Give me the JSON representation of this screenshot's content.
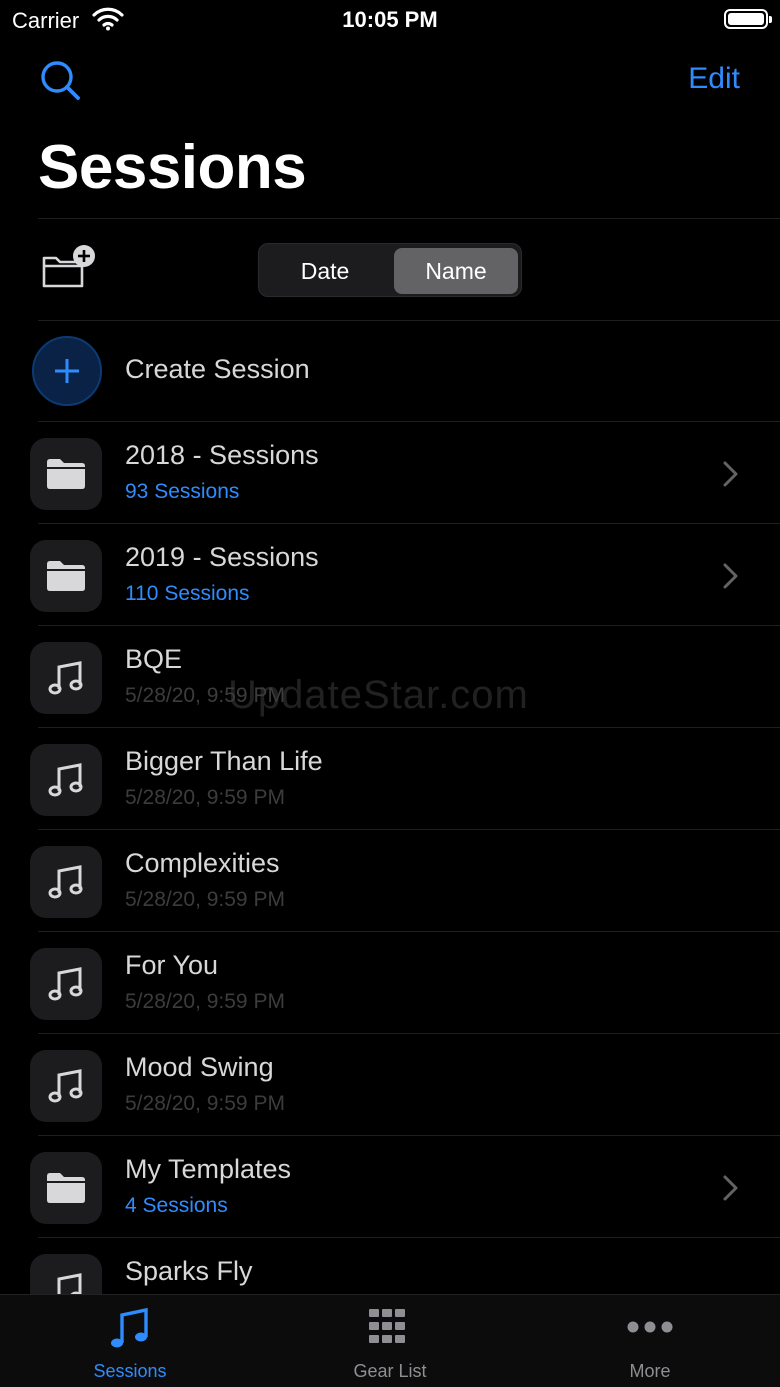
{
  "status_bar": {
    "carrier": "Carrier",
    "time": "10:05 PM"
  },
  "nav": {
    "edit_label": "Edit"
  },
  "title": "Sessions",
  "sort": {
    "date_label": "Date",
    "name_label": "Name",
    "selected": "Name"
  },
  "create_label": "Create Session",
  "rows": [
    {
      "title": "2018 - Sessions",
      "subtitle": "93 Sessions",
      "kind": "folder"
    },
    {
      "title": "2019 - Sessions",
      "subtitle": "110 Sessions",
      "kind": "folder"
    },
    {
      "title": "BQE",
      "subtitle": "5/28/20, 9:59 PM",
      "kind": "session"
    },
    {
      "title": "Bigger Than Life",
      "subtitle": "5/28/20, 9:59 PM",
      "kind": "session"
    },
    {
      "title": "Complexities",
      "subtitle": "5/28/20, 9:59 PM",
      "kind": "session"
    },
    {
      "title": "For You",
      "subtitle": "5/28/20, 9:59 PM",
      "kind": "session"
    },
    {
      "title": "Mood Swing",
      "subtitle": "5/28/20, 9:59 PM",
      "kind": "session"
    },
    {
      "title": "My Templates",
      "subtitle": "4 Sessions",
      "kind": "folder"
    },
    {
      "title": "Sparks Fly",
      "subtitle": "",
      "kind": "session"
    }
  ],
  "watermark": "UpdateStar.com",
  "tabs": [
    {
      "label": "Sessions",
      "icon": "music-note-icon",
      "active": true
    },
    {
      "label": "Gear List",
      "icon": "grid-icon",
      "active": false
    },
    {
      "label": "More",
      "icon": "ellipsis-icon",
      "active": false
    }
  ],
  "colors": {
    "accent": "#2f8cff",
    "background": "#000000",
    "cell": "#1c1c1e"
  }
}
